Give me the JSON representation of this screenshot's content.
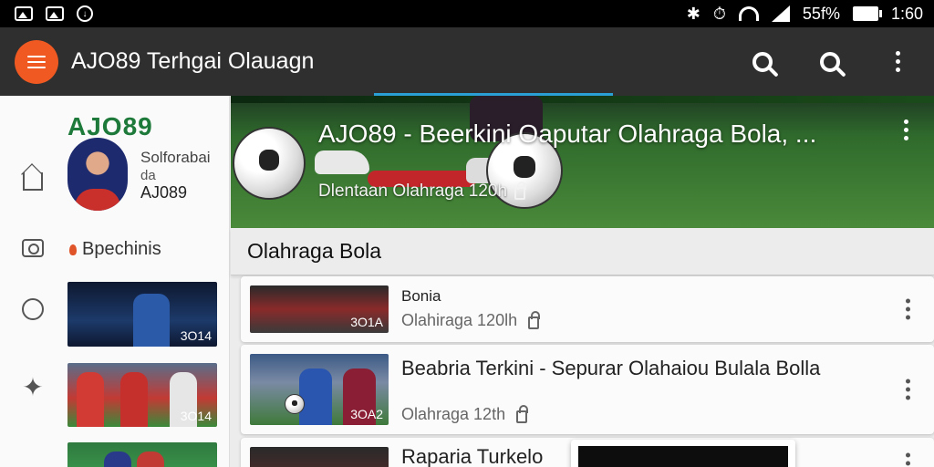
{
  "status_bar": {
    "left_icons": [
      "image-icon",
      "gallery-icon",
      "download-icon"
    ],
    "battery_percent": "55f%",
    "time": "1:60"
  },
  "app_bar": {
    "title": "AJO89 Terhgai Olauagn",
    "actions": [
      "search-icon",
      "search-icon",
      "more-vert-icon"
    ],
    "colors": {
      "bar": "#2f2f2f",
      "menu_button": "#f05a22",
      "indicator": "#2a9fd6"
    }
  },
  "drawer": {
    "brand": "AJO89",
    "profile_label": "Solforabai",
    "profile_sub": "da",
    "profile_name": "AJ089",
    "nav_icons": [
      "home-icon",
      "camera-icon",
      "chat-icon",
      "star-icon"
    ],
    "category_label": "Bpechinis",
    "thumbnails": [
      {
        "label": "3O14"
      },
      {
        "label": "3O14"
      },
      {
        "label": ""
      }
    ]
  },
  "hero": {
    "title": "AJO89 - Beerkini Oaputar Olahraga Bola,  ...",
    "subtitle": "Dlentaan Olahraga 120h"
  },
  "section": {
    "title": "Olahraga Bola"
  },
  "articles": [
    {
      "title": "Bonia",
      "meta": "Olahiraga 120lh",
      "thumb_label": "3O1A"
    },
    {
      "title": "Beabria Terkini - Sepurar Olahaiou Bulala Bolla",
      "meta": "Olahraga 12th",
      "thumb_label": "3OA2"
    },
    {
      "title": "Raparia Turkelo",
      "meta": "",
      "thumb_label": ""
    }
  ]
}
